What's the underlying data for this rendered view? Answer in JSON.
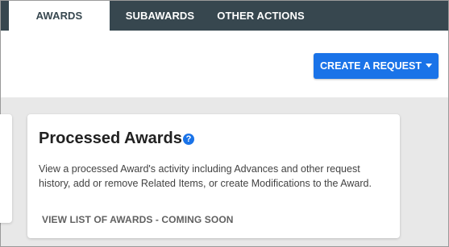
{
  "nav": {
    "tabs": [
      {
        "label": "AWARDS",
        "active": true
      },
      {
        "label": "SUBAWARDS",
        "active": false
      },
      {
        "label": "OTHER ACTIONS",
        "active": false
      }
    ]
  },
  "toolbar": {
    "create_request_label": "CREATE A REQUEST",
    "create_request_icon": "caret-down-icon"
  },
  "card": {
    "title": "Processed Awards",
    "help_icon": "?",
    "description": "View a processed Award's activity including Advances and other request history, add or remove Related Items, or create Modifications to the Award.",
    "link_label": "VIEW LIST OF AWARDS - COMING SOON"
  },
  "colors": {
    "nav_background": "#37474f",
    "accent": "#1a73e8",
    "page_background": "#e8e8e8"
  }
}
